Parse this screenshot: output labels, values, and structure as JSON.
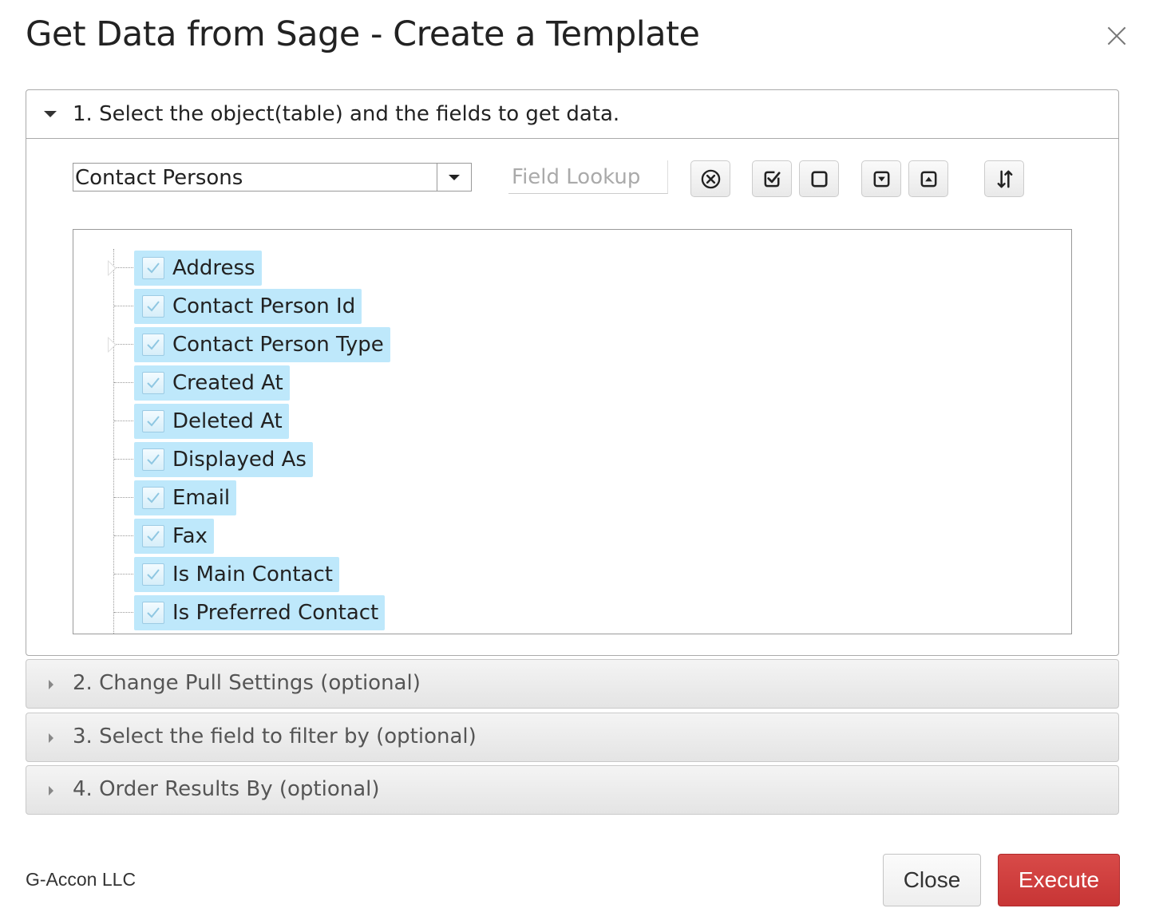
{
  "dialog": {
    "title": "Get Data from Sage - Create a Template",
    "close_icon": "close-icon"
  },
  "section1": {
    "label": "1. Select the object(table) and the fields to get data.",
    "object_select": {
      "value": "Contact Persons"
    },
    "field_lookup": {
      "value": "",
      "placeholder": "Field Lookup"
    },
    "toolbar_icons": [
      "clear-icon",
      "check-all-icon",
      "uncheck-all-icon",
      "expand-all-icon",
      "collapse-all-icon",
      "sort-icon"
    ],
    "tree": [
      {
        "label": "Address",
        "checked": true,
        "expandable": true
      },
      {
        "label": "Contact Person Id",
        "checked": true,
        "expandable": false
      },
      {
        "label": "Contact Person Type",
        "checked": true,
        "expandable": true
      },
      {
        "label": "Created At",
        "checked": true,
        "expandable": false
      },
      {
        "label": "Deleted At",
        "checked": true,
        "expandable": false
      },
      {
        "label": "Displayed As",
        "checked": true,
        "expandable": false
      },
      {
        "label": "Email",
        "checked": true,
        "expandable": false
      },
      {
        "label": "Fax",
        "checked": true,
        "expandable": false
      },
      {
        "label": "Is Main Contact",
        "checked": true,
        "expandable": false
      },
      {
        "label": "Is Preferred Contact",
        "checked": true,
        "expandable": false
      }
    ]
  },
  "section2": {
    "label": "2. Change Pull Settings (optional)"
  },
  "section3": {
    "label": "3. Select the field to filter by (optional)"
  },
  "section4": {
    "label": "4. Order Results By (optional)"
  },
  "footer": {
    "brand": "G-Accon LLC",
    "close_label": "Close",
    "execute_label": "Execute"
  },
  "colors": {
    "selected_node_bg": "#bee8fb",
    "execute_bg": "#cd3b3a"
  }
}
